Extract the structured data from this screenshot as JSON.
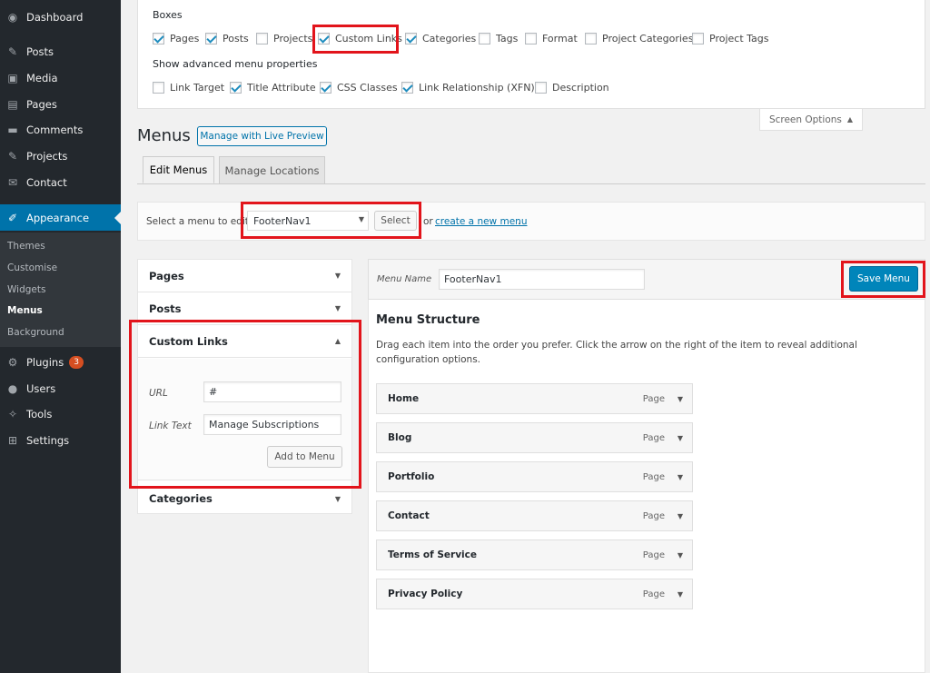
{
  "sidebar": {
    "items": [
      {
        "label": "Dashboard",
        "icon": "dashboard-icon"
      },
      {
        "label": "Posts",
        "icon": "pin-icon"
      },
      {
        "label": "Media",
        "icon": "media-icon"
      },
      {
        "label": "Pages",
        "icon": "pages-icon"
      },
      {
        "label": "Comments",
        "icon": "comment-icon"
      },
      {
        "label": "Projects",
        "icon": "pin-icon"
      },
      {
        "label": "Contact",
        "icon": "mail-icon"
      },
      {
        "label": "Appearance",
        "icon": "brush-icon"
      },
      {
        "label": "Plugins",
        "icon": "plugin-icon"
      },
      {
        "label": "Users",
        "icon": "user-icon"
      },
      {
        "label": "Tools",
        "icon": "wrench-icon"
      },
      {
        "label": "Settings",
        "icon": "settings-icon"
      }
    ],
    "submenu": [
      "Themes",
      "Customise",
      "Widgets",
      "Menus",
      "Background"
    ],
    "plugins_badge": "3",
    "colors": {
      "background": "#23282d",
      "active": "#0073aa"
    }
  },
  "screen_options": {
    "boxes_label": "Boxes",
    "boxes": [
      {
        "label": "Pages",
        "checked": true
      },
      {
        "label": "Posts",
        "checked": true
      },
      {
        "label": "Projects",
        "checked": false
      },
      {
        "label": "Custom Links",
        "checked": true
      },
      {
        "label": "Categories",
        "checked": true
      },
      {
        "label": "Tags",
        "checked": false
      },
      {
        "label": "Format",
        "checked": false
      },
      {
        "label": "Project Categories",
        "checked": false
      },
      {
        "label": "Project Tags",
        "checked": false
      }
    ],
    "advanced_label": "Show advanced menu properties",
    "advanced": [
      {
        "label": "Link Target",
        "checked": false
      },
      {
        "label": "Title Attribute",
        "checked": true
      },
      {
        "label": "CSS Classes",
        "checked": true
      },
      {
        "label": "Link Relationship (XFN)",
        "checked": true
      },
      {
        "label": "Description",
        "checked": false
      }
    ],
    "toggle_label": "Screen Options"
  },
  "page": {
    "title": "Menus",
    "live_preview": "Manage with Live Preview",
    "tabs": [
      "Edit Menus",
      "Manage Locations"
    ],
    "select_prompt": "Select a menu to edit:",
    "selected_menu": "FooterNav1",
    "select_button": "Select",
    "or_text": "or",
    "create_link": "create a new menu",
    "create_period": "."
  },
  "left_panel": {
    "sections": [
      "Pages",
      "Posts",
      "Custom Links",
      "Categories"
    ],
    "url_label": "URL",
    "url_value": "#",
    "link_text_label": "Link Text",
    "link_text_value": "Manage Subscriptions",
    "add_button": "Add to Menu"
  },
  "menu_edit": {
    "name_label": "Menu Name",
    "name_value": "FooterNav1",
    "save_button": "Save Menu",
    "structure_title": "Menu Structure",
    "instructions": "Drag each item into the order you prefer. Click the arrow on the right of the item to reveal additional configuration options.",
    "items": [
      {
        "title": "Home",
        "type": "Page"
      },
      {
        "title": "Blog",
        "type": "Page"
      },
      {
        "title": "Portfolio",
        "type": "Page"
      },
      {
        "title": "Contact",
        "type": "Page"
      },
      {
        "title": "Terms of Service",
        "type": "Page"
      },
      {
        "title": "Privacy Policy",
        "type": "Page"
      }
    ]
  },
  "highlight_color": "#e2141b"
}
